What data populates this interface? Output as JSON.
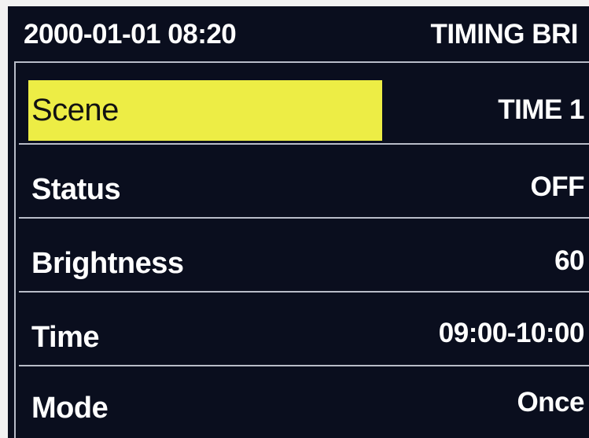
{
  "header": {
    "datetime": "2000-01-01 08:20",
    "title": "TIMING BRI"
  },
  "menu": {
    "selected_index": 0,
    "items": [
      {
        "label": "Scene",
        "value": "TIME 1"
      },
      {
        "label": "Status",
        "value": "OFF"
      },
      {
        "label": "Brightness",
        "value": "60"
      },
      {
        "label": "Time",
        "value": "09:00-10:00"
      },
      {
        "label": "Mode",
        "value": "Once"
      }
    ]
  },
  "colors": {
    "screen_background": "#0a0e1e",
    "highlight": "#eded45",
    "text": "#ffffff",
    "divider": "#b8bcc8"
  }
}
